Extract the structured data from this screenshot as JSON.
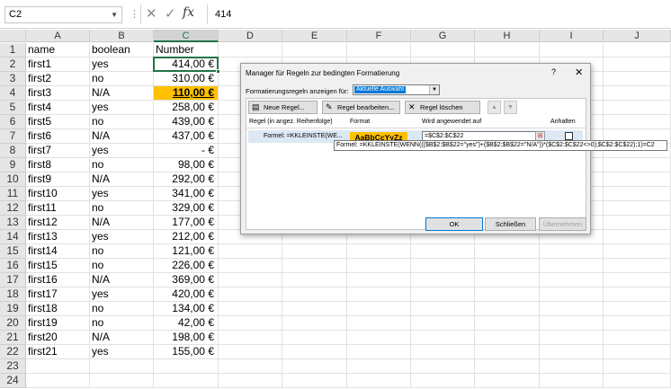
{
  "formula_bar": {
    "cell_ref": "C2",
    "cancel_icon": "✕",
    "enter_icon": "✓",
    "fx": "fx",
    "value": "414"
  },
  "columns": [
    "A",
    "B",
    "C",
    "D",
    "E",
    "F",
    "G",
    "H",
    "I",
    "J"
  ],
  "selected_column": "C",
  "rows": [
    {
      "n": "1",
      "a": "name",
      "b": "boolean",
      "c": "Number"
    },
    {
      "n": "2",
      "a": "first1",
      "b": "yes",
      "c": "414,00 €"
    },
    {
      "n": "3",
      "a": "first2",
      "b": "no",
      "c": "310,00 €"
    },
    {
      "n": "4",
      "a": "first3",
      "b": "N/A",
      "c": "110,00 €"
    },
    {
      "n": "5",
      "a": "first4",
      "b": "yes",
      "c": "258,00 €"
    },
    {
      "n": "6",
      "a": "first5",
      "b": "no",
      "c": "439,00 €"
    },
    {
      "n": "7",
      "a": "first6",
      "b": "N/A",
      "c": "437,00 €"
    },
    {
      "n": "8",
      "a": "first7",
      "b": "yes",
      "c": "-      €"
    },
    {
      "n": "9",
      "a": "first8",
      "b": "no",
      "c": "98,00 €"
    },
    {
      "n": "10",
      "a": "first9",
      "b": "N/A",
      "c": "292,00 €"
    },
    {
      "n": "11",
      "a": "first10",
      "b": "yes",
      "c": "341,00 €"
    },
    {
      "n": "12",
      "a": "first11",
      "b": "no",
      "c": "329,00 €"
    },
    {
      "n": "13",
      "a": "first12",
      "b": "N/A",
      "c": "177,00 €"
    },
    {
      "n": "14",
      "a": "first13",
      "b": "yes",
      "c": "212,00 €"
    },
    {
      "n": "15",
      "a": "first14",
      "b": "no",
      "c": "121,00 €"
    },
    {
      "n": "16",
      "a": "first15",
      "b": "no",
      "c": "226,00 €"
    },
    {
      "n": "17",
      "a": "first16",
      "b": "N/A",
      "c": "369,00 €"
    },
    {
      "n": "18",
      "a": "first17",
      "b": "yes",
      "c": "420,00 €"
    },
    {
      "n": "19",
      "a": "first18",
      "b": "no",
      "c": "134,00 €"
    },
    {
      "n": "20",
      "a": "first19",
      "b": "no",
      "c": "42,00 €"
    },
    {
      "n": "21",
      "a": "first20",
      "b": "N/A",
      "c": "198,00 €"
    },
    {
      "n": "22",
      "a": "first21",
      "b": "yes",
      "c": "155,00 €"
    },
    {
      "n": "23",
      "a": "",
      "b": "",
      "c": ""
    },
    {
      "n": "24",
      "a": "",
      "b": "",
      "c": ""
    }
  ],
  "highlighted_row": "4",
  "highlight_color": "#ffc000",
  "dialog": {
    "title": "Manager für Regeln zur bedingten Formatierung",
    "help": "?",
    "close": "✕",
    "show_label": "Formatierungsregeln anzeigen für:",
    "show_value": "Aktuelle Auswahl",
    "toolbar": {
      "new_rule": "Neue Regel...",
      "edit_rule": "Regel bearbeiten...",
      "delete_rule": "Regel löschen",
      "up": "▲",
      "down": "▼"
    },
    "headers": {
      "rule": "Regel (in angez. Reihenfolge)",
      "format": "Format",
      "applies_to": "Wird angewendet auf",
      "stop": "Anhalten"
    },
    "rule": {
      "formula": "Formel: =KKLEINSTE(WE...",
      "format_preview": "AaBbCcYyZz",
      "applies_to": "=$C$2:$C$22"
    },
    "tooltip": "Formel: =KKLEINSTE(WENN((($B$2:$B$22=\"yes\")+($B$2:$B$22=\"N/A\"))*($C$2:$C$22<>0);$C$2:$C$22);1)=C2",
    "buttons": {
      "ok": "OK",
      "close": "Schließen",
      "apply": "Übernehmen"
    }
  }
}
